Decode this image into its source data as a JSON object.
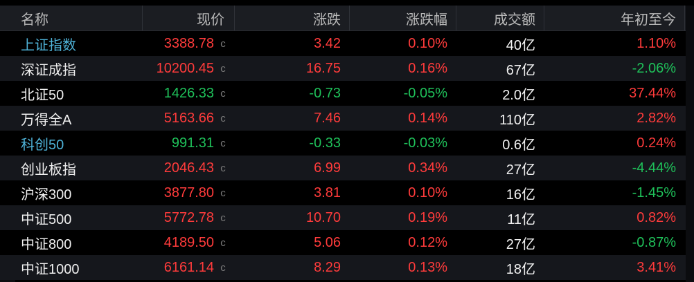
{
  "header": {
    "name": "名称",
    "price": "现价",
    "change": "涨跌",
    "pct": "涨跌幅",
    "volume": "成交额",
    "ytd": "年初至今"
  },
  "flag_glyph": "c",
  "rows": [
    {
      "name": "上证指数",
      "name_color": "#4fb3d9",
      "price": "3388.78",
      "price_dir": "up",
      "change": "3.42",
      "change_dir": "up",
      "pct": "0.10%",
      "pct_dir": "up",
      "volume": "40亿",
      "ytd": "1.10%",
      "ytd_dir": "up"
    },
    {
      "name": "深证成指",
      "name_color": "#f0f0f0",
      "price": "10200.45",
      "price_dir": "up",
      "change": "16.75",
      "change_dir": "up",
      "pct": "0.16%",
      "pct_dir": "up",
      "volume": "67亿",
      "ytd": "-2.06%",
      "ytd_dir": "down"
    },
    {
      "name": "北证50",
      "name_color": "#f0f0f0",
      "price": "1426.33",
      "price_dir": "down",
      "change": "-0.73",
      "change_dir": "down",
      "pct": "-0.05%",
      "pct_dir": "down",
      "volume": "2.0亿",
      "ytd": "37.44%",
      "ytd_dir": "up"
    },
    {
      "name": "万得全A",
      "name_color": "#f0f0f0",
      "price": "5163.66",
      "price_dir": "up",
      "change": "7.46",
      "change_dir": "up",
      "pct": "0.14%",
      "pct_dir": "up",
      "volume": "110亿",
      "ytd": "2.82%",
      "ytd_dir": "up"
    },
    {
      "name": "科创50",
      "name_color": "#4fb3d9",
      "price": "991.31",
      "price_dir": "down",
      "change": "-0.33",
      "change_dir": "down",
      "pct": "-0.03%",
      "pct_dir": "down",
      "volume": "0.6亿",
      "ytd": "0.24%",
      "ytd_dir": "up"
    },
    {
      "name": "创业板指",
      "name_color": "#f0f0f0",
      "price": "2046.43",
      "price_dir": "up",
      "change": "6.99",
      "change_dir": "up",
      "pct": "0.34%",
      "pct_dir": "up",
      "volume": "27亿",
      "ytd": "-4.44%",
      "ytd_dir": "down"
    },
    {
      "name": "沪深300",
      "name_color": "#f0f0f0",
      "price": "3877.80",
      "price_dir": "up",
      "change": "3.81",
      "change_dir": "up",
      "pct": "0.10%",
      "pct_dir": "up",
      "volume": "16亿",
      "ytd": "-1.45%",
      "ytd_dir": "down"
    },
    {
      "name": "中证500",
      "name_color": "#f0f0f0",
      "price": "5772.78",
      "price_dir": "up",
      "change": "10.70",
      "change_dir": "up",
      "pct": "0.19%",
      "pct_dir": "up",
      "volume": "11亿",
      "ytd": "0.82%",
      "ytd_dir": "up"
    },
    {
      "name": "中证800",
      "name_color": "#f0f0f0",
      "price": "4189.50",
      "price_dir": "up",
      "change": "5.06",
      "change_dir": "up",
      "pct": "0.12%",
      "pct_dir": "up",
      "volume": "27亿",
      "ytd": "-0.87%",
      "ytd_dir": "down"
    },
    {
      "name": "中证1000",
      "name_color": "#f0f0f0",
      "price": "6161.14",
      "price_dir": "up",
      "change": "8.29",
      "change_dir": "up",
      "pct": "0.13%",
      "pct_dir": "up",
      "volume": "18亿",
      "ytd": "3.41%",
      "ytd_dir": "up"
    }
  ],
  "colors": {
    "up": "#ff3b3b",
    "down": "#1fc15a",
    "index_link": "#4fb3d9",
    "background": "#000000",
    "header_bg": "#1b1d22"
  }
}
